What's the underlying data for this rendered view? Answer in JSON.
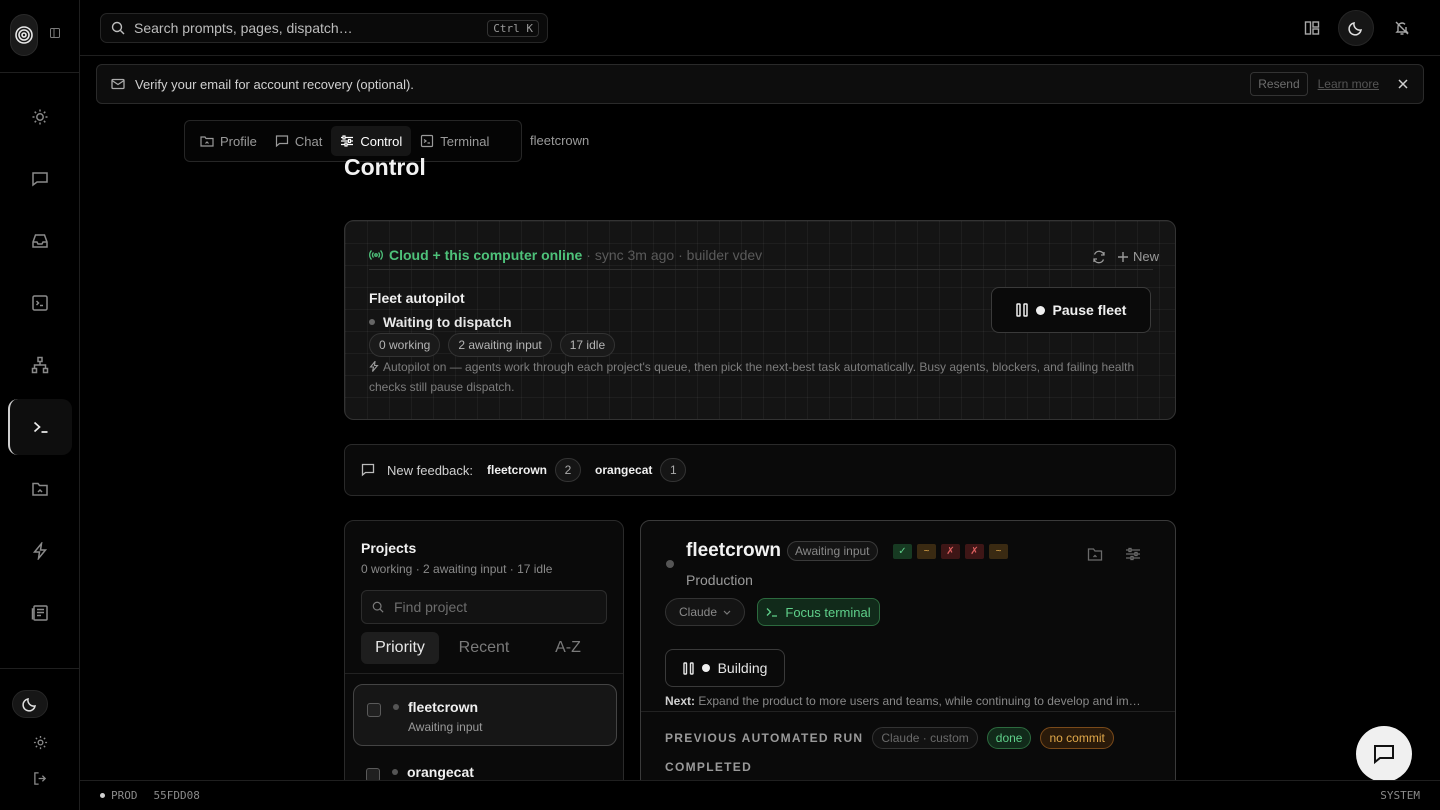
{
  "rail": {
    "logo_icon": "spiral-logo-icon",
    "items": [
      {
        "name": "sun-icon"
      },
      {
        "name": "chat-icon"
      },
      {
        "name": "inbox-icon"
      },
      {
        "name": "terminal-box-icon"
      },
      {
        "name": "sitemap-icon"
      },
      {
        "name": "prompt-icon",
        "active": true
      },
      {
        "name": "folder-icon"
      },
      {
        "name": "bolt-icon"
      },
      {
        "name": "newspaper-icon"
      }
    ]
  },
  "search": {
    "placeholder": "Search prompts, pages, dispatch…",
    "shortcut": "Ctrl K"
  },
  "banner": {
    "text": "Verify your email for account recovery (optional).",
    "resend_label": "Resend",
    "learn_more_label": "Learn more"
  },
  "tabs": [
    {
      "label": "Profile",
      "icon": "folder-icon"
    },
    {
      "label": "Chat",
      "icon": "chat-icon"
    },
    {
      "label": "Control",
      "icon": "sliders-icon",
      "active": true
    },
    {
      "label": "Terminal",
      "icon": "terminal-icon"
    }
  ],
  "breadcrumb": "fleetcrown",
  "page_title": "Control",
  "fleet": {
    "online_label": "Cloud + this computer online",
    "meta": "· sync 3m ago · builder vdev",
    "new_label": "New",
    "title": "Fleet autopilot",
    "status": "Waiting to dispatch",
    "pills": [
      "0 working",
      "2 awaiting input",
      "17 idle"
    ],
    "description": "Autopilot on — agents work through each project's queue, then pick the next-best task automatically. Busy agents, blockers, and failing health checks still pause dispatch.",
    "pause_label": "Pause fleet"
  },
  "feedback": {
    "label": "New feedback:",
    "items": [
      {
        "project": "fleetcrown",
        "count": "2"
      },
      {
        "project": "orangecat",
        "count": "1"
      }
    ]
  },
  "projects": {
    "title": "Projects",
    "summary": "0 working · 2 awaiting input · 17 idle",
    "find_placeholder": "Find project",
    "sort": [
      "Priority",
      "Recent",
      "A-Z"
    ],
    "list": [
      {
        "name": "fleetcrown",
        "status": "Awaiting input",
        "selected": true
      },
      {
        "name": "orangecat",
        "status": ""
      }
    ]
  },
  "detail": {
    "name": "fleetcrown",
    "badge": "Awaiting input",
    "chips": [
      {
        "glyph": "✓",
        "kind": "pass"
      },
      {
        "glyph": "~",
        "kind": "warn"
      },
      {
        "glyph": "✗",
        "kind": "fail"
      },
      {
        "glyph": "✗",
        "kind": "fail"
      },
      {
        "glyph": "~",
        "kind": "warn"
      }
    ],
    "environment": "Production",
    "agent_select": "Claude",
    "focus_label": "Focus terminal",
    "building_label": "Building",
    "next_label": "Next:",
    "next_text": "Expand the product to more users and teams, while continuing to develop and im…",
    "prev_run_label": "PREVIOUS AUTOMATED RUN",
    "prev_tags": [
      "Claude · custom",
      "done",
      "no commit"
    ],
    "completed_label": "COMPLETED"
  },
  "footer": {
    "env": "PROD",
    "build": "55FDD08",
    "theme": "SYSTEM"
  },
  "colors": {
    "accent_green": "#4ec27a",
    "warn_orange": "#e0a84a",
    "fail_red": "#e06060"
  }
}
